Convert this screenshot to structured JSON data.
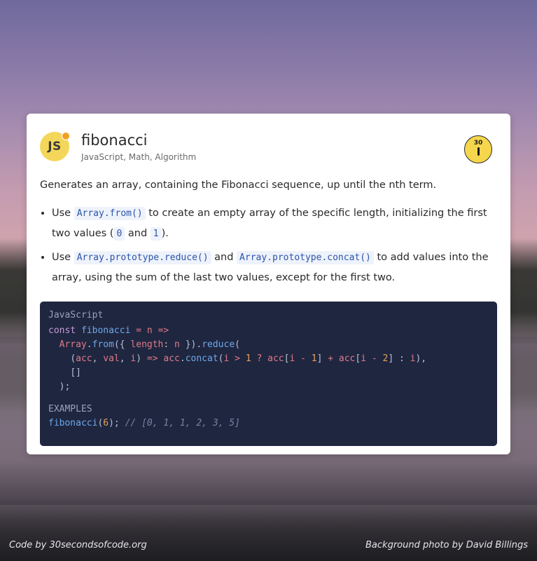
{
  "snippet": {
    "badge": "JS",
    "title": "fibonacci",
    "tags": "JavaScript, Math, Algorithm",
    "logo_number": "30",
    "description": "Generates an array, containing the Fibonacci sequence, up until the nth term.",
    "points": [
      {
        "pre": "Use ",
        "code1": "Array.from()",
        "mid": " to create an empty array of the specific length, initializing the first two values (",
        "code2": "0",
        "and": " and ",
        "code3": "1",
        "post": ")."
      },
      {
        "pre": "Use ",
        "code1": "Array.prototype.reduce()",
        "mid": " and ",
        "code2": "Array.prototype.concat()",
        "post": " to add values into the array, using the sum of the last two values, except for the first two."
      }
    ],
    "code_language": "JavaScript",
    "examples_label": "EXAMPLES"
  },
  "footer": {
    "left": "Code by 30secondsofcode.org",
    "right": "Background photo by David Billings"
  }
}
